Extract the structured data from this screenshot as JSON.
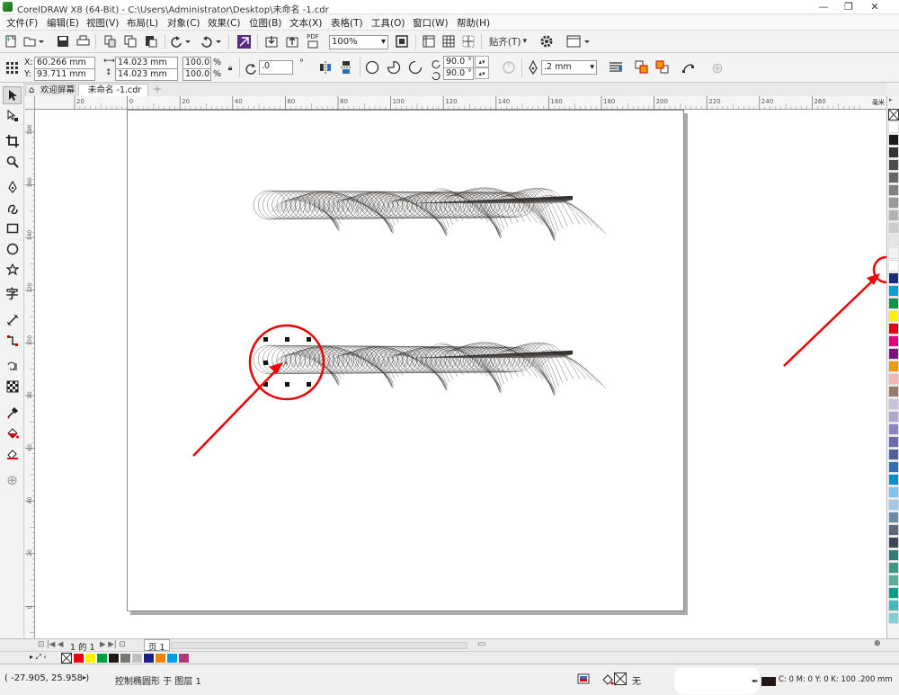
{
  "window": {
    "title": "CorelDRAW X8 (64-Bit) - C:\\Users\\Administrator\\Desktop\\未命名 -1.cdr",
    "controls": {
      "minimize": "—",
      "restore": "❐",
      "close": "✕"
    }
  },
  "menu": {
    "items": [
      "文件(F)",
      "编辑(E)",
      "视图(V)",
      "布局(L)",
      "对象(C)",
      "效果(C)",
      "位图(B)",
      "文本(X)",
      "表格(T)",
      "工具(O)",
      "窗口(W)",
      "帮助(H)"
    ]
  },
  "toolbar": {
    "zoom_value": "100%",
    "snap_label": "贴齐(T)",
    "pdf_label": "PDF"
  },
  "property_bar": {
    "x_label": "X:",
    "x_value": "60.266 mm",
    "y_label": "Y:",
    "y_value": "93.711 mm",
    "width_value": "14.023 mm",
    "height_value": "14.023 mm",
    "scale_w": "100.0",
    "scale_h": "100.0",
    "percent": "%",
    "rotation": ".0",
    "angle_start": "90.0 °",
    "angle_end": "90.0 °",
    "outline_width": ".2 mm"
  },
  "tabs": {
    "welcome": "欢迎屏幕",
    "document": "未命名 -1.cdr",
    "add": "+"
  },
  "ruler": {
    "h_labels": [
      "20",
      "0",
      "20",
      "40",
      "60",
      "80",
      "100",
      "120",
      "140",
      "160",
      "180",
      "200",
      "220",
      "240",
      "260"
    ],
    "unit": "毫米",
    "v_labels": [
      "180",
      "160",
      "140",
      "120",
      "100",
      "80",
      "60",
      "40",
      "20",
      "0"
    ]
  },
  "page_nav": {
    "page_of": "1 的 1",
    "page_tab": "页 1"
  },
  "statusbar": {
    "coords": "( -27.905, 25.958 )",
    "status_text": "控制椭圆形 于 图层 1",
    "fill_none": "无",
    "outline_info": "C: 0 M: 0 Y: 0 K: 100  .200 mm"
  },
  "palette": {
    "colors": [
      "#ffffff",
      "#1a1a1a",
      "#333333",
      "#4d4d4d",
      "#666666",
      "#808080",
      "#999999",
      "#b3b3b3",
      "#cccccc",
      "#e6e6e6",
      "#f2f2f2",
      "#ffffff",
      "#1c2a86",
      "#00a0e0",
      "#009944",
      "#fff100",
      "#e60012",
      "#e4007f",
      "#7f1184",
      "#f39800",
      "#f5b5b5",
      "#9c7a6a",
      "#ccc2e0",
      "#b0a6d0",
      "#8c86c0",
      "#6a6aae",
      "#4f5f9a",
      "#2f70b8",
      "#0090d8",
      "#78c8f0",
      "#a0c8e8",
      "#6a8aa8",
      "#5a6a7a",
      "#3a4a5a",
      "#2a7f7a",
      "#3a9a8a",
      "#5ab0a0",
      "#00a08a",
      "#40b8c0",
      "#80d0d8"
    ],
    "doc_colors": [
      "#e60012",
      "#fff100",
      "#00a040",
      "#231815",
      "#777777",
      "#bfbfbf",
      "#1d2088",
      "#f08300",
      "#00a0e9",
      "#b0357a"
    ]
  }
}
